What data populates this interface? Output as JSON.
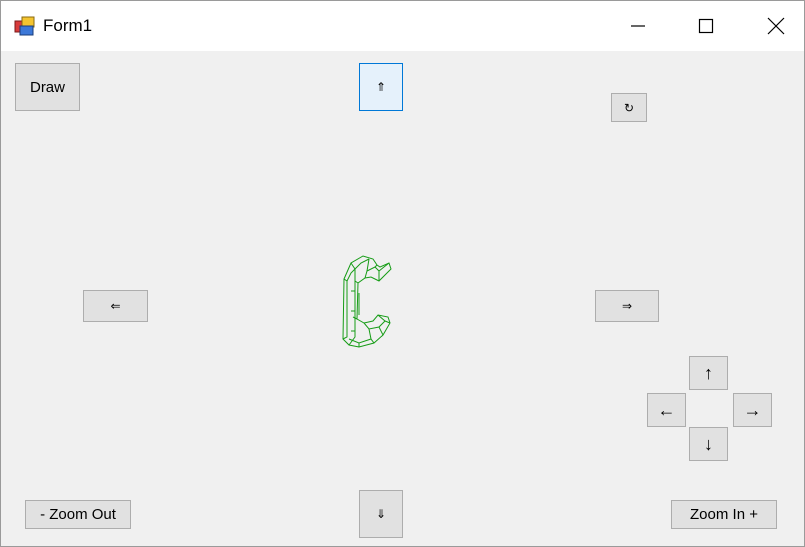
{
  "window": {
    "title": "Form1",
    "icon": "form-app-icon",
    "controls": {
      "minimize": "minimize-icon",
      "maximize": "maximize-icon",
      "close": "close-icon"
    }
  },
  "buttons": {
    "draw": "Draw",
    "move_up": "⇑",
    "move_down": "⇓",
    "move_left": "⇐",
    "move_right": "⇒",
    "rotate": "↻",
    "rot_up": "↑",
    "rot_down": "↓",
    "rot_left": "←",
    "rot_right": "→",
    "zoom_out": "- Zoom Out",
    "zoom_in": "Zoom In +"
  },
  "canvas": {
    "shape": "wireframe-c-shape",
    "stroke_color": "#169c16"
  }
}
